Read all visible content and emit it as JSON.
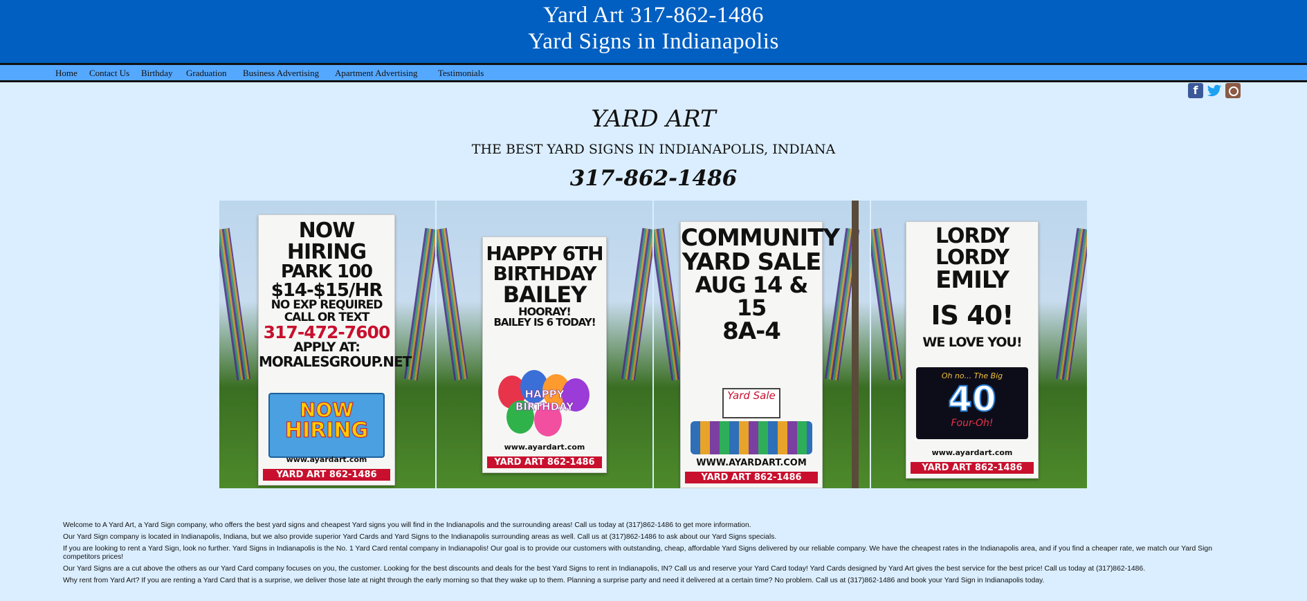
{
  "header": {
    "line1": "Yard Art 317-862-1486",
    "line2": "Yard Signs in Indianapolis"
  },
  "nav": {
    "items": [
      {
        "label": "Home"
      },
      {
        "label": "Contact Us"
      },
      {
        "label": "Birthday"
      },
      {
        "label": "Graduation"
      },
      {
        "label": "Business Advertising"
      },
      {
        "label": "Apartment Advertising"
      },
      {
        "label": "Testimonials"
      }
    ]
  },
  "social": {
    "facebook_glyph": "f",
    "twitter_glyph": "🐦",
    "icons": [
      "facebook-icon",
      "twitter-icon",
      "instagram-icon"
    ]
  },
  "brand": {
    "title": "YARD ART",
    "subtitle": "THE BEST YARD SIGNS IN INDIANAPOLIS, INDIANA",
    "phone": "317-862-1486"
  },
  "gallery": {
    "photo1": {
      "line1": "NOW HIRING",
      "line2": "PARK 100",
      "line3": "$14-$15/HR",
      "line4": "NO EXP REQUIRED",
      "line5": "CALL OR TEXT",
      "line6": "317-472-7600",
      "line7": "APPLY AT:",
      "line8": "MORALESGROUP.NET",
      "badge1": "NOW",
      "badge2": "HIRING",
      "url": "www.ayardart.com",
      "footer": "YARD ART 862-1486"
    },
    "photo2": {
      "line1": "HAPPY 6TH",
      "line2": "BIRTHDAY",
      "line3": "BAILEY",
      "line4": "HOORAY!",
      "line5": "BAILEY IS 6 TODAY!",
      "badge1": "HAPPY",
      "badge2": "BIRTHDAY",
      "url": "www.ayardart.com",
      "footer": "YARD ART 862-1486"
    },
    "photo3": {
      "line1": "COMMUNITY",
      "line2": "YARD SALE",
      "line3": "AUG 14 & 15",
      "line4": "8A-4",
      "badge": "Yard Sale",
      "url": "WWW.AYARDART.COM",
      "footer": "YARD ART 862-1486"
    },
    "photo4": {
      "line1": "LORDY LORDY",
      "line2": "EMILY",
      "line3": "IS 40!",
      "line4": "WE LOVE YOU!",
      "badge_top": "Oh no... The Big",
      "badge_num": "40",
      "badge_bottom": "Four-Oh!",
      "url": "www.ayardart.com",
      "footer": "YARD ART 862-1486"
    }
  },
  "content": {
    "p1": "Welcome to A Yard Art, a Yard Sign company, who offers the best yard signs and cheapest Yard signs you will find in the Indianapolis and the surrounding areas!  Call us today at (317)862-1486 to get more information.",
    "p2": "Our Yard Sign company is located in Indianapolis, Indiana, but we also provide superior Yard Cards and Yard Signs to the Indianapolis surrounding areas as well.  Call us at (317)862-1486 to ask about our Yard Signs specials.",
    "p3": "If you are looking to rent a Yard Sign, look no further.  Yard Signs in Indianapolis is the No. 1 Yard Card rental company in Indianapolis!  Our goal is to provide our customers with outstanding, cheap, affordable Yard Signs delivered by our reliable company.  We have the cheapest rates in the Indianapolis area, and if you find a cheaper rate, we match our Yard Sign competitors prices!",
    "p4": "Our Yard Signs are a cut above the others as our Yard Card company focuses on you, the customer.  Looking for the best discounts and deals for the best Yard Signs to rent in Indianapolis, IN?  Call us and reserve your Yard Card today!  Yard Cards designed by Yard Art gives the best service for the best price!  Call us today at (317)862-1486.",
    "p5": "Why rent from Yard Art?  If you are renting a Yard Card that is a surprise, we deliver those late at night through the early morning so that they wake up to them.  Planning a surprise party and need it delivered at a certain time?  No problem.  Call us at (317)862-1486 and book your Yard Sign in Indianapolis today."
  }
}
